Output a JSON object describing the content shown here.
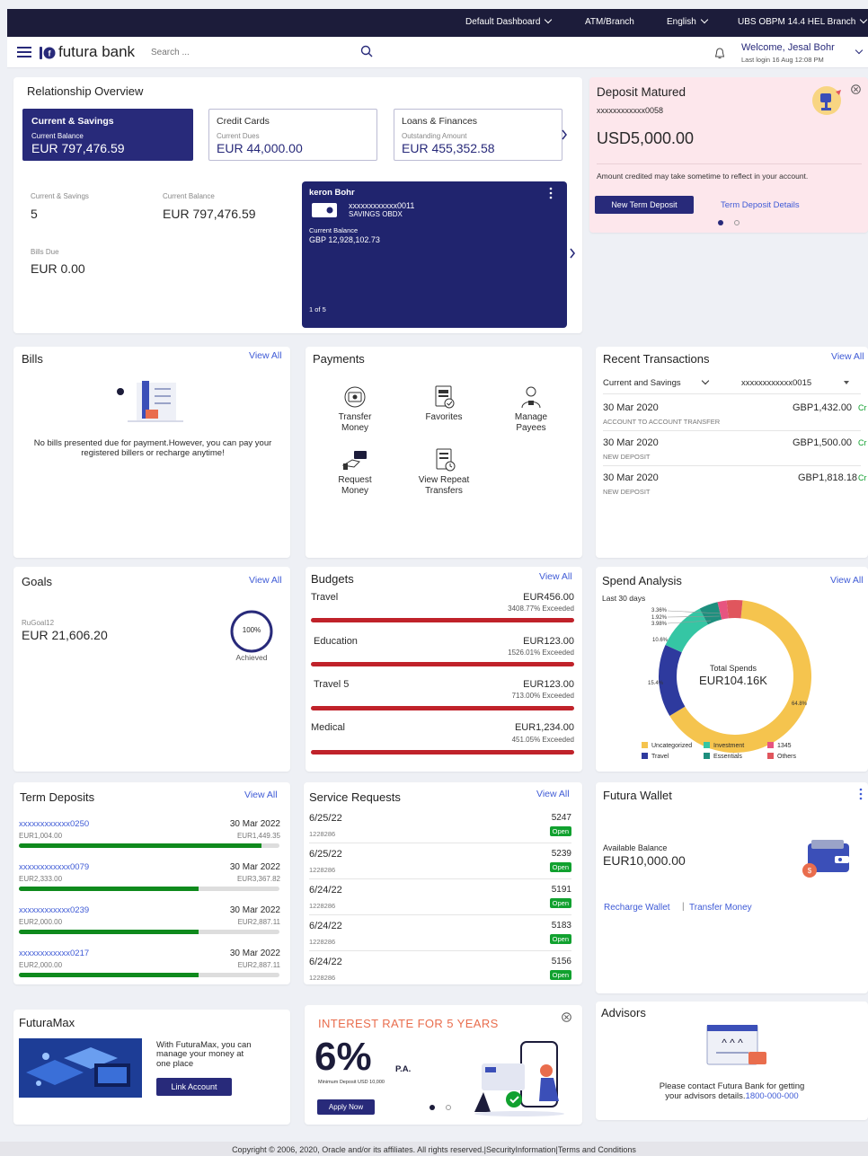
{
  "topbar": {
    "dashboard": "Default Dashboard",
    "atm": "ATM/Branch",
    "language": "English",
    "branch": "UBS OBPM 14.4 HEL Branch"
  },
  "header": {
    "brand": "futura bank",
    "search_placeholder": "Search ...",
    "welcome": "Welcome, Jesal Bohr",
    "last_login": "Last login 16 Aug 12:08 PM"
  },
  "relationship": {
    "title": "Relationship Overview",
    "tabs": [
      {
        "title": "Current & Savings",
        "sub": "Current Balance",
        "amount": "EUR 797,476.59"
      },
      {
        "title": "Credit Cards",
        "sub": "Current Dues",
        "amount": "EUR 44,000.00"
      },
      {
        "title": "Loans & Finances",
        "sub": "Outstanding Amount",
        "amount": "EUR 455,352.58"
      }
    ],
    "stats": {
      "cs_label": "Current & Savings",
      "cs_value": "5",
      "cb_label": "Current Balance",
      "cb_value": "EUR 797,476.59",
      "bills_label": "Bills Due",
      "bills_value": "EUR 0.00"
    },
    "account_card": {
      "name": "keron Bohr",
      "number": "xxxxxxxxxxxx0011",
      "type": "SAVINGS OBDX",
      "bal_label": "Current Balance",
      "bal_value": "GBP 12,928,102.73",
      "pager": "1 of 5"
    }
  },
  "deposit": {
    "title": "Deposit Matured",
    "account": "xxxxxxxxxxxx0058",
    "amount": "USD5,000.00",
    "note": "Amount credited may take sometime to reflect in your account.",
    "new_btn": "New Term Deposit",
    "details_link": "Term Deposit Details"
  },
  "bills": {
    "title": "Bills",
    "view_all": "View All",
    "message": "No bills presented due for payment.However, you can pay your registered billers or recharge anytime!"
  },
  "payments": {
    "title": "Payments",
    "items": [
      {
        "label1": "Transfer",
        "label2": "Money"
      },
      {
        "label1": "Favorites",
        "label2": ""
      },
      {
        "label1": "Manage",
        "label2": "Payees"
      },
      {
        "label1": "Request",
        "label2": "Money"
      },
      {
        "label1": "View Repeat",
        "label2": "Transfers"
      }
    ]
  },
  "recent": {
    "title": "Recent Transactions",
    "view_all": "View All",
    "filter_type": "Current and Savings",
    "filter_account": "xxxxxxxxxxxx0015",
    "rows": [
      {
        "date": "30 Mar 2020",
        "amount": "GBP1,432.00",
        "cr": "Cr",
        "desc": "ACCOUNT TO ACCOUNT TRANSFER"
      },
      {
        "date": "30 Mar 2020",
        "amount": "GBP1,500.00",
        "cr": "Cr",
        "desc": "NEW DEPOSIT"
      },
      {
        "date": "30 Mar 2020",
        "amount": "GBP1,818.18",
        "cr": "Cr",
        "desc": "NEW DEPOSIT"
      }
    ]
  },
  "goals": {
    "title": "Goals",
    "view_all": "View All",
    "name": "RuGoal12",
    "amount": "EUR 21,606.20",
    "percent": "100%",
    "status": "Achieved"
  },
  "budgets": {
    "title": "Budgets",
    "view_all": "View All",
    "items": [
      {
        "name": "Travel",
        "amount": "EUR456.00",
        "status": "3408.77% Exceeded"
      },
      {
        "name": "Education",
        "amount": "EUR123.00",
        "status": "1526.01% Exceeded"
      },
      {
        "name": "Travel 5",
        "amount": "EUR123.00",
        "status": "713.00% Exceeded"
      },
      {
        "name": "Medical",
        "amount": "EUR1,234.00",
        "status": "451.05% Exceeded"
      }
    ]
  },
  "spend": {
    "title": "Spend Analysis",
    "view_all": "View All",
    "period": "Last 30 days",
    "center_label": "Total Spends",
    "center_value": "EUR104.16K"
  },
  "chart_data": {
    "type": "pie",
    "categories": [
      "Uncategorized",
      "Travel",
      "Investment",
      "Essentials",
      "1345",
      "Others"
    ],
    "values": [
      64.8,
      15.4,
      10.6,
      3.98,
      1.92,
      3.36
    ],
    "labels": [
      "64.8%",
      "15.4%",
      "10.6%",
      "3.98%",
      "1.92%",
      "3.36%"
    ],
    "colors": [
      "#f5c44e",
      "#2e3a9e",
      "#35c6a4",
      "#1e8f7e",
      "#e75480",
      "#e0565d"
    ],
    "legend": "bottom"
  },
  "term_deposits": {
    "title": "Term Deposits",
    "view_all": "View All",
    "rows": [
      {
        "account": "xxxxxxxxxxxx0250",
        "date": "30 Mar 2022",
        "principal": "EUR1,004.00",
        "maturity": "EUR1,449.35",
        "progress": 0.93
      },
      {
        "account": "xxxxxxxxxxxx0079",
        "date": "30 Mar 2022",
        "principal": "EUR2,333.00",
        "maturity": "EUR3,367.82",
        "progress": 0.69
      },
      {
        "account": "xxxxxxxxxxxx0239",
        "date": "30 Mar 2022",
        "principal": "EUR2,000.00",
        "maturity": "EUR2,887.11",
        "progress": 0.69
      },
      {
        "account": "xxxxxxxxxxxx0217",
        "date": "30 Mar 2022",
        "principal": "EUR2,000.00",
        "maturity": "EUR2,887.11",
        "progress": 0.69
      }
    ]
  },
  "service": {
    "title": "Service Requests",
    "view_all": "View All",
    "rows": [
      {
        "date": "6/25/22",
        "ref": "1228286",
        "id": "5247",
        "status": "Open"
      },
      {
        "date": "6/25/22",
        "ref": "1228286",
        "id": "5239",
        "status": "Open"
      },
      {
        "date": "6/24/22",
        "ref": "1228286",
        "id": "5191",
        "status": "Open"
      },
      {
        "date": "6/24/22",
        "ref": "1228286",
        "id": "5183",
        "status": "Open"
      },
      {
        "date": "6/24/22",
        "ref": "1228286",
        "id": "5156",
        "status": "Open"
      }
    ]
  },
  "wallet": {
    "title": "Futura Wallet",
    "bal_label": "Available Balance",
    "bal_value": "EUR10,000.00",
    "recharge": "Recharge Wallet",
    "separator": "|",
    "transfer": "Transfer Money"
  },
  "futuramax": {
    "title": "FuturaMax",
    "text1": "With FuturaMax, you can",
    "text2": "manage your money at",
    "text3": "one place",
    "button": "Link Account"
  },
  "promo": {
    "title": "INTEREST RATE FOR 5 YEARS",
    "rate": "6%",
    "pa": "P.A.",
    "min": "Minimum Deposit USD 10,000",
    "button": "Apply Now"
  },
  "advisors": {
    "title": "Advisors",
    "line1": "Please contact Futura Bank for getting",
    "line2": "your advisors details.",
    "phone": "1800-000-000"
  },
  "footer": {
    "text": "Copyright © 2006, 2020, Oracle and/or its affiliates. All rights reserved.|SecurityInformation|Terms and Conditions"
  },
  "colors": {
    "navy": "#1c1c3a",
    "accent": "#282a7a",
    "link": "#3f5bd6",
    "success": "#11a12f",
    "danger": "#c0222a",
    "deposit_bg": "#fde7ec"
  }
}
